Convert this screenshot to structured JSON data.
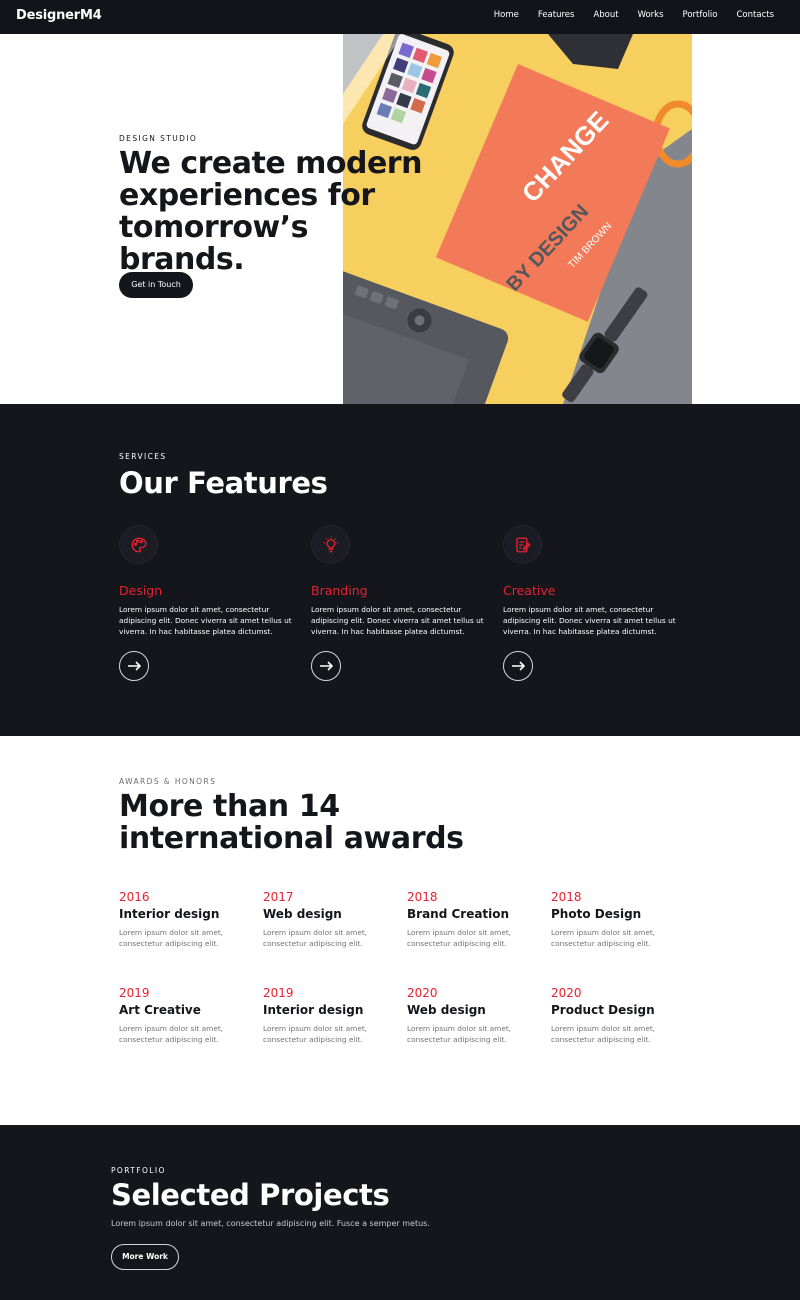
{
  "nav": {
    "brand": "DesignerM4",
    "links": [
      "Home",
      "Features",
      "About",
      "Works",
      "Portfolio",
      "Contacts"
    ]
  },
  "hero": {
    "eyebrow": "DESIGN STUDIO",
    "title": "We create modern experiences for tomorrow’s brands.",
    "cta": "Get in Touch",
    "image": {
      "book_line1": "CHANGE",
      "book_line2": "BY DESIGN",
      "book_author": "TIM BROWN"
    }
  },
  "features": {
    "eyebrow": "SERVICES",
    "title": "Our Features",
    "items": [
      {
        "title": "Design",
        "icon": "palette-icon",
        "desc": "Lorem ipsum dolor sit amet, consectetur adipiscing elit. Donec viverra sit amet tellus ut viverra. In hac habitasse platea dictumst."
      },
      {
        "title": "Branding",
        "icon": "lightbulb-icon",
        "desc": "Lorem ipsum dolor sit amet, consectetur adipiscing elit. Donec viverra sit amet tellus ut viverra. In hac habitasse platea dictumst."
      },
      {
        "title": "Creative",
        "icon": "edit-document-icon",
        "desc": "Lorem ipsum dolor sit amet, consectetur adipiscing elit. Donec viverra sit amet tellus ut viverra. In hac habitasse platea dictumst."
      }
    ]
  },
  "awards": {
    "eyebrow": "AWARDS & HONORS",
    "title": "More than 14 international awards",
    "items": [
      {
        "year": "2016",
        "name": "Interior design",
        "desc": "Lorem ipsum dolor sit amet, consectetur adipiscing elit."
      },
      {
        "year": "2017",
        "name": "Web design",
        "desc": "Lorem ipsum dolor sit amet, consectetur adipiscing elit."
      },
      {
        "year": "2018",
        "name": "Brand Creation",
        "desc": "Lorem ipsum dolor sit amet, consectetur adipiscing elit."
      },
      {
        "year": "2018",
        "name": "Photo Design",
        "desc": "Lorem ipsum dolor sit amet, consectetur adipiscing elit."
      },
      {
        "year": "2019",
        "name": "Art Creative",
        "desc": "Lorem ipsum dolor sit amet, consectetur adipiscing elit."
      },
      {
        "year": "2019",
        "name": "Interior design",
        "desc": "Lorem ipsum dolor sit amet, consectetur adipiscing elit."
      },
      {
        "year": "2020",
        "name": "Web design",
        "desc": "Lorem ipsum dolor sit amet, consectetur adipiscing elit."
      },
      {
        "year": "2020",
        "name": "Product Design",
        "desc": "Lorem ipsum dolor sit amet, consectetur adipiscing elit."
      }
    ]
  },
  "portfolio": {
    "eyebrow": "PORTFOLIO",
    "title": "Selected Projects",
    "subtitle": "Lorem ipsum dolor sit amet, consectetur adipiscing elit. Fusce a semper metus.",
    "cta": "More Work"
  },
  "colors": {
    "accent": "#e8202f",
    "dark": "#15161c",
    "hero_yellow": "#f7cf5e",
    "book_orange": "#f37a58"
  }
}
